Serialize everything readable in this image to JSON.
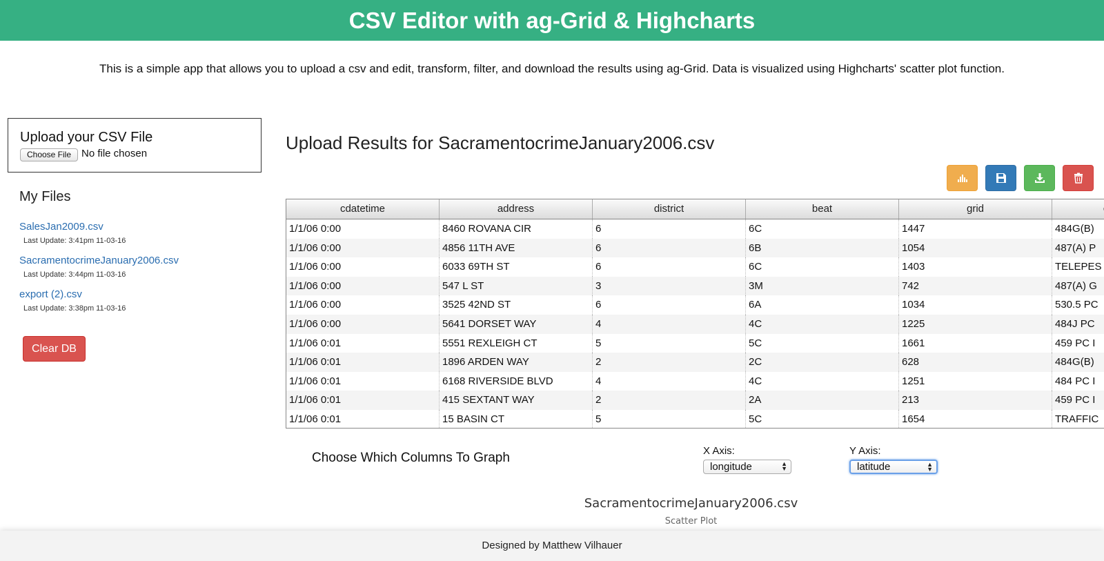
{
  "header": {
    "title": "CSV Editor with ag-Grid & Highcharts"
  },
  "intro": "This is a simple app that allows you to upload a csv and edit, transform, filter, and download the results using ag-Grid. Data is visualized using Highcharts' scatter plot function.",
  "upload": {
    "title": "Upload your CSV File",
    "choose_label": "Choose File",
    "no_file": "No file chosen"
  },
  "my_files": {
    "title": "My Files",
    "files": [
      {
        "name": "SalesJan2009.csv",
        "updated": "Last Update: 3:41pm 11-03-16"
      },
      {
        "name": "SacramentocrimeJanuary2006.csv",
        "updated": "Last Update: 3:44pm 11-03-16"
      },
      {
        "name": "export (2).csv",
        "updated": "Last Update: 3:38pm 11-03-16"
      }
    ],
    "clear_label": "Clear DB"
  },
  "results": {
    "title": "Upload Results for SacramentocrimeJanuary2006.csv",
    "toolbar": [
      {
        "icon": "bar-chart-icon",
        "color": "#f0ad4e"
      },
      {
        "icon": "save-icon",
        "color": "#337ab7"
      },
      {
        "icon": "download-icon",
        "color": "#5cb85c"
      },
      {
        "icon": "trash-icon",
        "color": "#d9534f"
      }
    ]
  },
  "grid": {
    "columns": [
      "cdatetime",
      "address",
      "district",
      "beat",
      "grid",
      "crimedescr"
    ],
    "rows": [
      [
        "1/1/06 0:00",
        "8460 ROVANA CIR",
        "6",
        "6C",
        "1447",
        "484G(B)"
      ],
      [
        "1/1/06 0:00",
        "4856 11TH AVE",
        "6",
        "6B",
        "1054",
        "487(A) P"
      ],
      [
        "1/1/06 0:00",
        "6033 69TH ST",
        "6",
        "6C",
        "1403",
        "TELEPES"
      ],
      [
        "1/1/06 0:00",
        "547 L ST",
        "3",
        "3M",
        "742",
        "487(A) G"
      ],
      [
        "1/1/06 0:00",
        "3525 42ND ST",
        "6",
        "6A",
        "1034",
        "530.5 PC"
      ],
      [
        "1/1/06 0:00",
        "5641 DORSET WAY",
        "4",
        "4C",
        "1225",
        "484J PC"
      ],
      [
        "1/1/06 0:01",
        "5551 REXLEIGH CT",
        "5",
        "5C",
        "1661",
        "459 PC I"
      ],
      [
        "1/1/06 0:01",
        "1896 ARDEN WAY",
        "2",
        "2C",
        "628",
        "484G(B)"
      ],
      [
        "1/1/06 0:01",
        "6168 RIVERSIDE BLVD",
        "4",
        "4C",
        "1251",
        "484 PC I"
      ],
      [
        "1/1/06 0:01",
        "415 SEXTANT WAY",
        "2",
        "2A",
        "213",
        "459 PC I"
      ],
      [
        "1/1/06 0:01",
        "15 BASIN CT",
        "5",
        "5C",
        "1654",
        "TRAFFIC"
      ]
    ]
  },
  "graph": {
    "title": "Choose Which Columns To Graph",
    "x_label": "X Axis:",
    "x_value": "longitude",
    "y_label": "Y Axis:",
    "y_value": "latitude"
  },
  "chart": {
    "title": "SacramentocrimeJanuary2006.csv",
    "subtitle": "Scatter Plot"
  },
  "footer": "Designed by Matthew Vilhauer"
}
